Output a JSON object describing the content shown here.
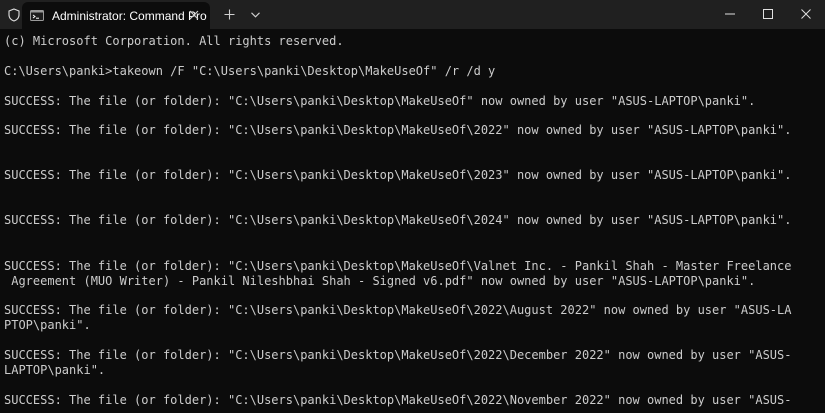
{
  "window": {
    "tab_title": "Administrator: Command Pro"
  },
  "icons": {
    "shield": "shield-icon",
    "terminal": "terminal-icon",
    "close": "close-icon",
    "plus": "plus-icon",
    "chevron": "chevron-down-icon",
    "minimize": "minimize-icon",
    "maximize": "maximize-icon"
  },
  "colors": {
    "titlebar": "#202020",
    "background": "#0c0c0c",
    "text": "#cccccc"
  },
  "console": {
    "lines": [
      "(c) Microsoft Corporation. All rights reserved.",
      "C:\\Users\\panki>takeown /F \"C:\\Users\\panki\\Desktop\\MakeUseOf\" /r /d y",
      "SUCCESS: The file (or folder): \"C:\\Users\\panki\\Desktop\\MakeUseOf\" now owned by user \"ASUS-LAPTOP\\panki\".",
      "SUCCESS: The file (or folder): \"C:\\Users\\panki\\Desktop\\MakeUseOf\\2022\" now owned by user \"ASUS-LAPTOP\\panki\".",
      "SUCCESS: The file (or folder): \"C:\\Users\\panki\\Desktop\\MakeUseOf\\2023\" now owned by user \"ASUS-LAPTOP\\panki\".",
      "SUCCESS: The file (or folder): \"C:\\Users\\panki\\Desktop\\MakeUseOf\\2024\" now owned by user \"ASUS-LAPTOP\\panki\".",
      "SUCCESS: The file (or folder): \"C:\\Users\\panki\\Desktop\\MakeUseOf\\Valnet Inc. - Pankil Shah - Master Freelance",
      " Agreement (MUO Writer) - Pankil Nileshbhai Shah - Signed v6.pdf\" now owned by user \"ASUS-LAPTOP\\panki\".",
      "SUCCESS: The file (or folder): \"C:\\Users\\panki\\Desktop\\MakeUseOf\\2022\\August 2022\" now owned by user \"ASUS-LA",
      "PTOP\\panki\".",
      "SUCCESS: The file (or folder): \"C:\\Users\\panki\\Desktop\\MakeUseOf\\2022\\December 2022\" now owned by user \"ASUS-",
      "LAPTOP\\panki\".",
      "SUCCESS: The file (or folder): \"C:\\Users\\panki\\Desktop\\MakeUseOf\\2022\\November 2022\" now owned by user \"ASUS-"
    ]
  }
}
